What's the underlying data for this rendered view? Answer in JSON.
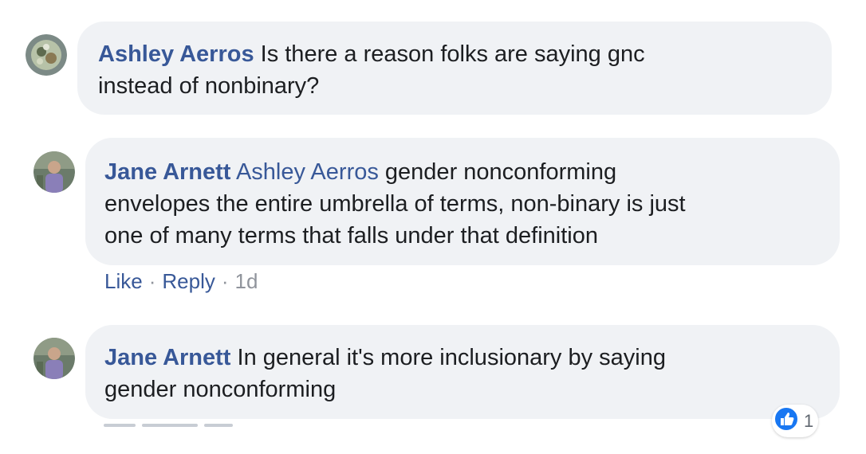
{
  "comments": [
    {
      "author": "Ashley Aerros",
      "mention": "",
      "text_line1": "Is there a reason folks are saying gnc",
      "text_line2": "instead of nonbinary?",
      "text_line3": ""
    },
    {
      "author": "Jane Arnett",
      "mention": "Ashley Aerros",
      "text_line1": "gender nonconforming",
      "text_line2": "envelopes the entire umbrella of terms, non-binary is just",
      "text_line3": "one of many terms that falls under that definition",
      "actions": {
        "like_label": "Like",
        "reply_label": "Reply",
        "separator": "·",
        "timestamp": "1d"
      }
    },
    {
      "author": "Jane Arnett",
      "mention": "",
      "text_line1": "In general it's more inclusionary by saying",
      "text_line2": "gender nonconforming",
      "text_line3": "",
      "reaction": {
        "icon": "like-thumb-icon",
        "count": "1"
      }
    }
  ],
  "colors": {
    "bubble": "#f0f2f5",
    "name": "#385898",
    "text": "#1c1e21",
    "meta": "#90949c",
    "like_blue": "#1877f2"
  }
}
